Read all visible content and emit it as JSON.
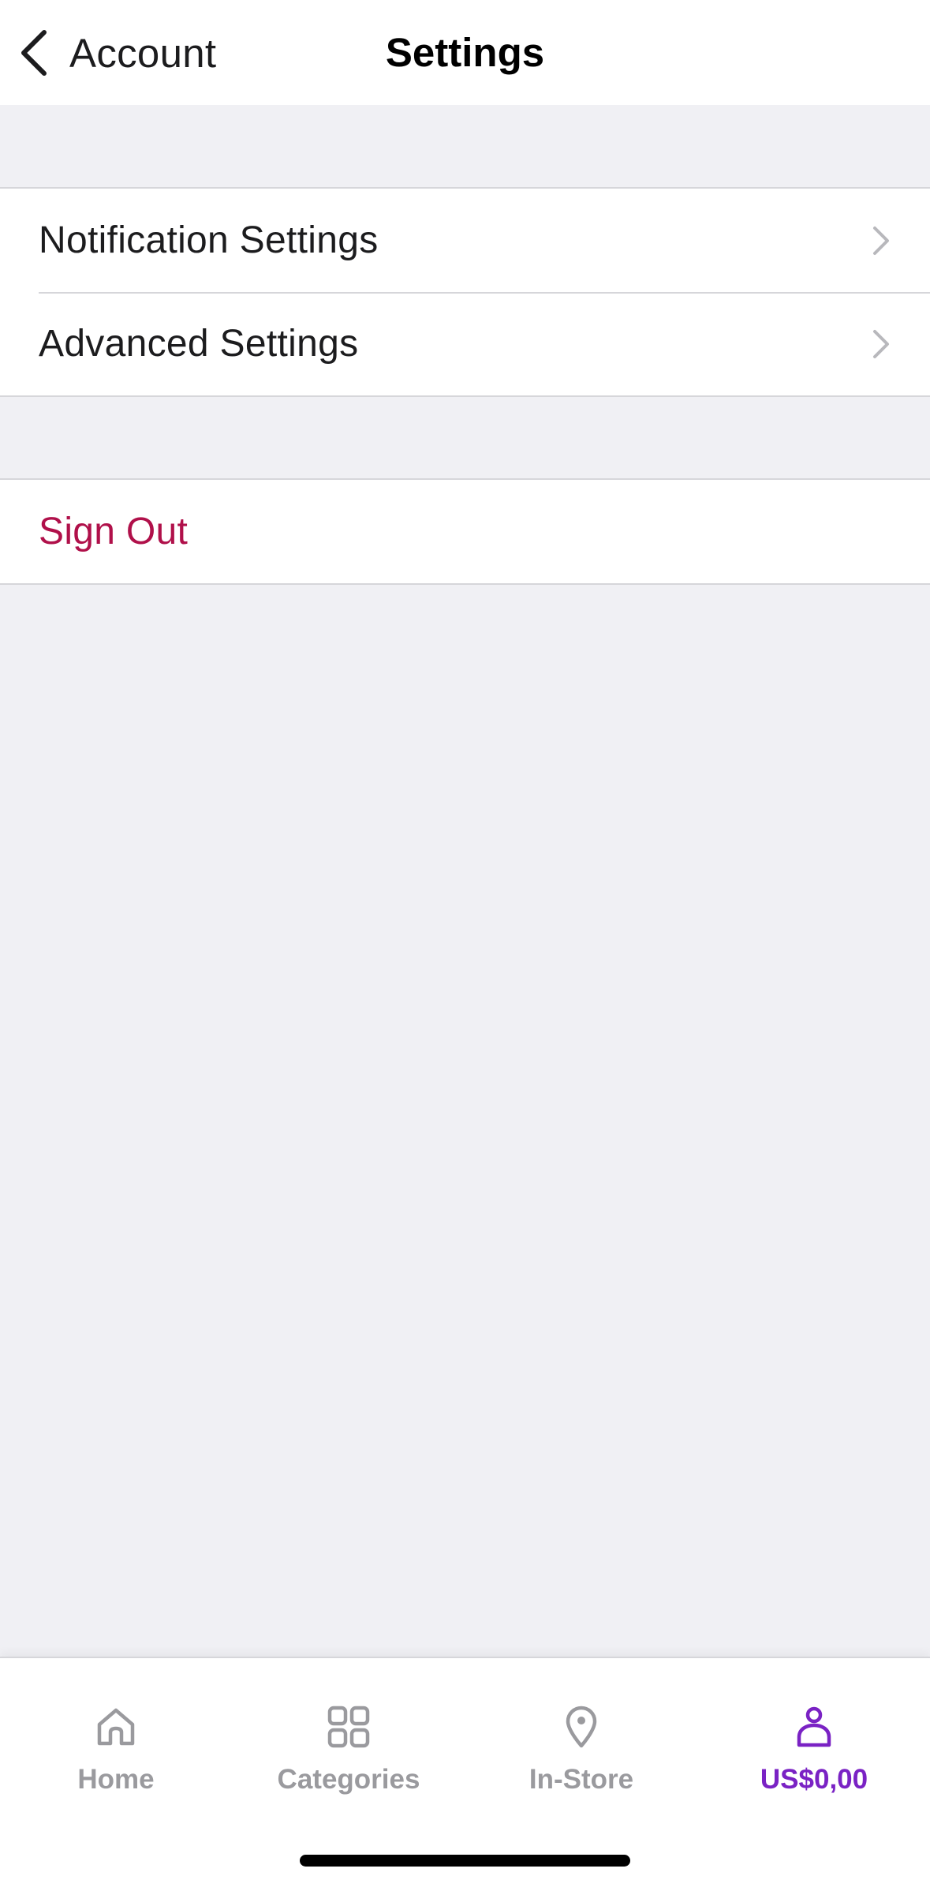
{
  "header": {
    "back_label": "Account",
    "title": "Settings",
    "back_icon": "chevron-left-icon"
  },
  "groups": [
    {
      "items": [
        {
          "label": "Notification Settings",
          "icon": "chevron-right-icon"
        },
        {
          "label": "Advanced Settings",
          "icon": "chevron-right-icon"
        }
      ]
    },
    {
      "items": [
        {
          "label": "Sign Out",
          "color": "#b0104a"
        }
      ]
    }
  ],
  "tabbar": {
    "tabs": [
      {
        "label": "Home",
        "icon": "home-icon",
        "active": false
      },
      {
        "label": "Categories",
        "icon": "grid-icon",
        "active": false
      },
      {
        "label": "In-Store",
        "icon": "location-pin-icon",
        "active": false
      },
      {
        "label": "US$0,00",
        "icon": "person-icon",
        "active": true
      }
    ],
    "active_color": "#7a22c4",
    "inactive_color": "#9a9a9e"
  }
}
